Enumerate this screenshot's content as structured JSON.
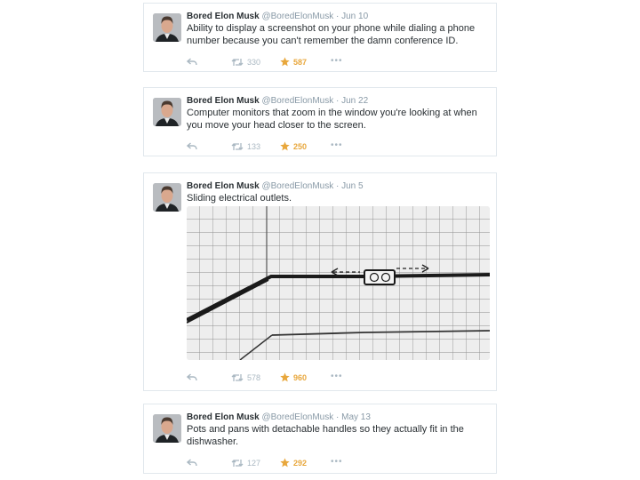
{
  "tweets": [
    {
      "name": "Bored Elon Musk",
      "handle": "@BoredElonMusk",
      "dot": "·",
      "date": "Jun 10",
      "text": "Ability to display a screenshot on your phone while dialing a phone number because you can't remember the damn conference ID.",
      "retweets": "330",
      "favorites": "587",
      "more": "•••"
    },
    {
      "name": "Bored Elon Musk",
      "handle": "@BoredElonMusk",
      "dot": "·",
      "date": "Jun 22",
      "text": "Computer monitors that zoom in the window you're looking at when you move your head closer to the screen.",
      "retweets": "133",
      "favorites": "250",
      "more": "•••"
    },
    {
      "name": "Bored Elon Musk",
      "handle": "@BoredElonMusk",
      "dot": "·",
      "date": "Jun 5",
      "text": "Sliding electrical outlets.",
      "retweets": "578",
      "favorites": "960",
      "more": "•••"
    },
    {
      "name": "Bored Elon Musk",
      "handle": "@BoredElonMusk",
      "dot": "·",
      "date": "May 13",
      "text": "Pots and pans with detachable handles so they actually fit in the dishwasher.",
      "retweets": "127",
      "favorites": "292",
      "more": "•••"
    }
  ],
  "icons": {
    "avatar": "avatar",
    "reply": "reply-icon",
    "retweet": "retweet-icon",
    "favorite": "star-icon",
    "more": "more-icon"
  },
  "colors": {
    "text": "#292f33",
    "meta": "#8899a6",
    "action": "#aab8c2",
    "favorite": "#e8a73c",
    "border": "#e1e8ed"
  }
}
